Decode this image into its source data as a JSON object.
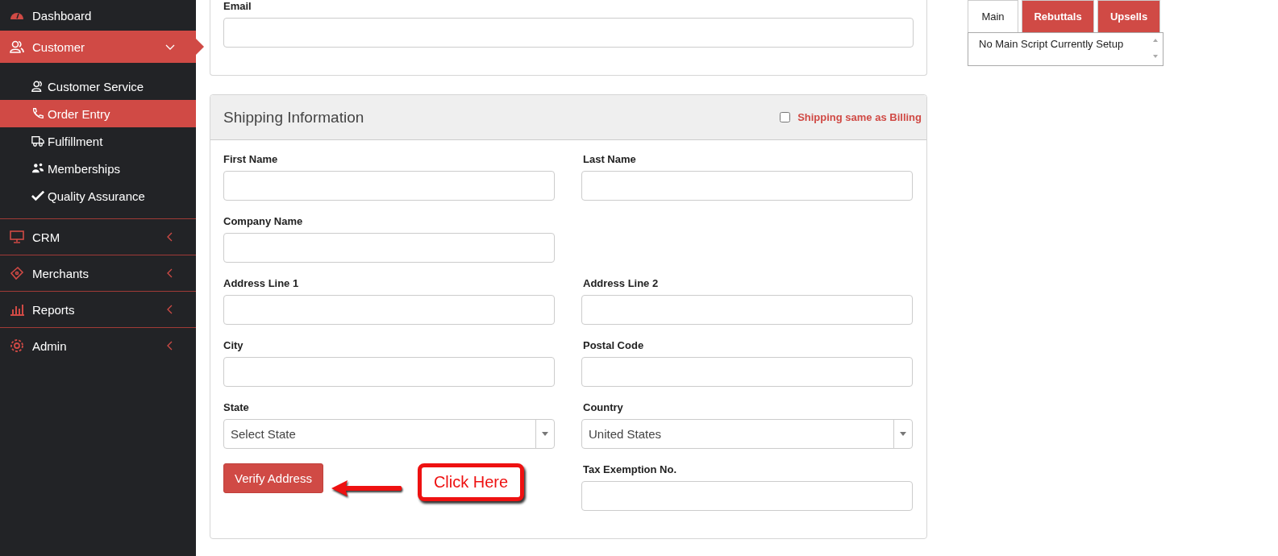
{
  "sidebar": {
    "items": [
      {
        "label": "Dashboard",
        "selected": false
      },
      {
        "label": "Customer",
        "selected": true,
        "expanded": true,
        "children": [
          {
            "label": "Customer Service",
            "selected": false
          },
          {
            "label": "Order Entry",
            "selected": true
          },
          {
            "label": "Fulfillment",
            "selected": false
          },
          {
            "label": "Memberships",
            "selected": false
          },
          {
            "label": "Quality Assurance",
            "selected": false
          }
        ]
      },
      {
        "label": "CRM",
        "selected": false,
        "expanded": false
      },
      {
        "label": "Merchants",
        "selected": false,
        "expanded": false
      },
      {
        "label": "Reports",
        "selected": false,
        "expanded": false
      },
      {
        "label": "Admin",
        "selected": false,
        "expanded": false
      }
    ]
  },
  "email_card": {
    "field_label": "Email"
  },
  "shipping": {
    "title": "Shipping Information",
    "same_as_billing": {
      "label": "Shipping same as Billing",
      "checked": false
    },
    "rows": [
      [
        {
          "kind": "text",
          "label": "First Name"
        },
        {
          "kind": "text",
          "label": "Last Name"
        }
      ],
      [
        {
          "kind": "text",
          "label": "Company Name"
        }
      ],
      [
        {
          "kind": "text",
          "label": "Address Line 1"
        },
        {
          "kind": "text",
          "label": "Address Line 2"
        }
      ],
      [
        {
          "kind": "text",
          "label": "City"
        },
        {
          "kind": "text",
          "label": "Postal Code"
        }
      ],
      [
        {
          "kind": "select",
          "label": "State",
          "value": "Select State"
        },
        {
          "kind": "select",
          "label": "Country",
          "value": "United States"
        }
      ],
      [
        {
          "kind": "button",
          "label": "Verify Address"
        },
        {
          "kind": "text",
          "label": "Tax Exemption No."
        }
      ]
    ]
  },
  "annotation": {
    "text": "Click Here"
  },
  "script_panel": {
    "tabs": [
      {
        "label": "Main",
        "selected": true
      },
      {
        "label": "Rebuttals",
        "selected": false
      },
      {
        "label": "Upsells",
        "selected": false
      }
    ],
    "content": "No Main Script Currently Setup"
  }
}
